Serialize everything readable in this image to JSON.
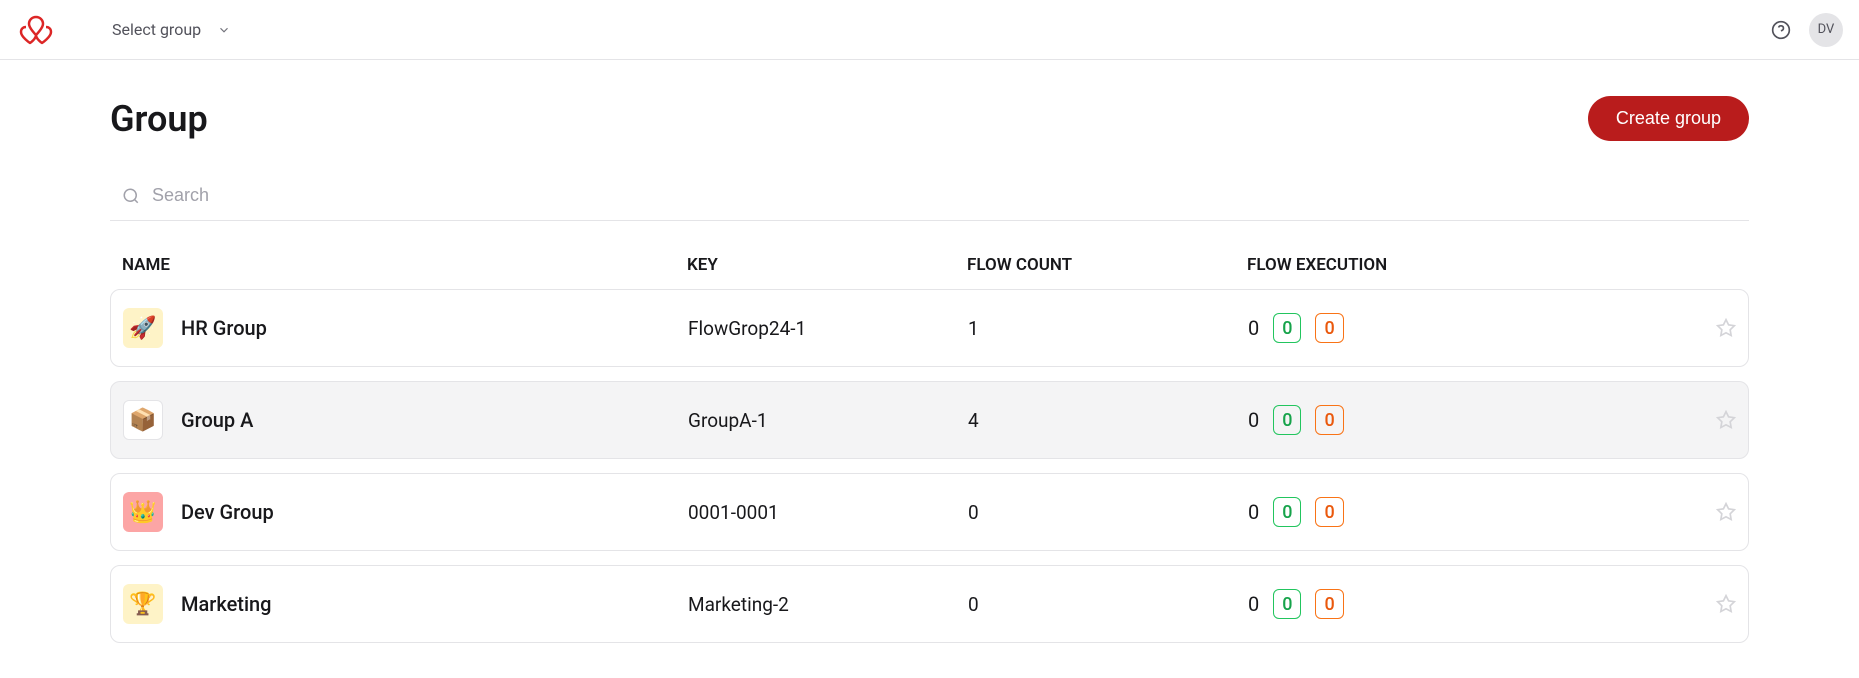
{
  "header": {
    "select_group_label": "Select group",
    "avatar_initials": "DV"
  },
  "page": {
    "title": "Group",
    "create_button": "Create group",
    "search_placeholder": "Search"
  },
  "columns": {
    "name": "NAME",
    "key": "KEY",
    "flow_count": "FLOW COUNT",
    "flow_execution": "FLOW EXECUTION"
  },
  "groups": [
    {
      "icon_emoji": "🚀",
      "icon_bg": "bg-yellow",
      "name": "HR Group",
      "key": "FlowGrop24-1",
      "flow_count": "1",
      "exec_plain": "0",
      "exec_green": "0",
      "exec_orange": "0",
      "highlight": false
    },
    {
      "icon_emoji": "📦",
      "icon_bg": "bg-white-b",
      "name": "Group A",
      "key": "GroupA-1",
      "flow_count": "4",
      "exec_plain": "0",
      "exec_green": "0",
      "exec_orange": "0",
      "highlight": true
    },
    {
      "icon_emoji": "👑",
      "icon_bg": "bg-salmon",
      "name": "Dev Group",
      "key": "0001-0001",
      "flow_count": "0",
      "exec_plain": "0",
      "exec_green": "0",
      "exec_orange": "0",
      "highlight": false
    },
    {
      "icon_emoji": "🏆",
      "icon_bg": "bg-cream",
      "name": "Marketing",
      "key": "Marketing-2",
      "flow_count": "0",
      "exec_plain": "0",
      "exec_green": "0",
      "exec_orange": "0",
      "highlight": false
    }
  ]
}
